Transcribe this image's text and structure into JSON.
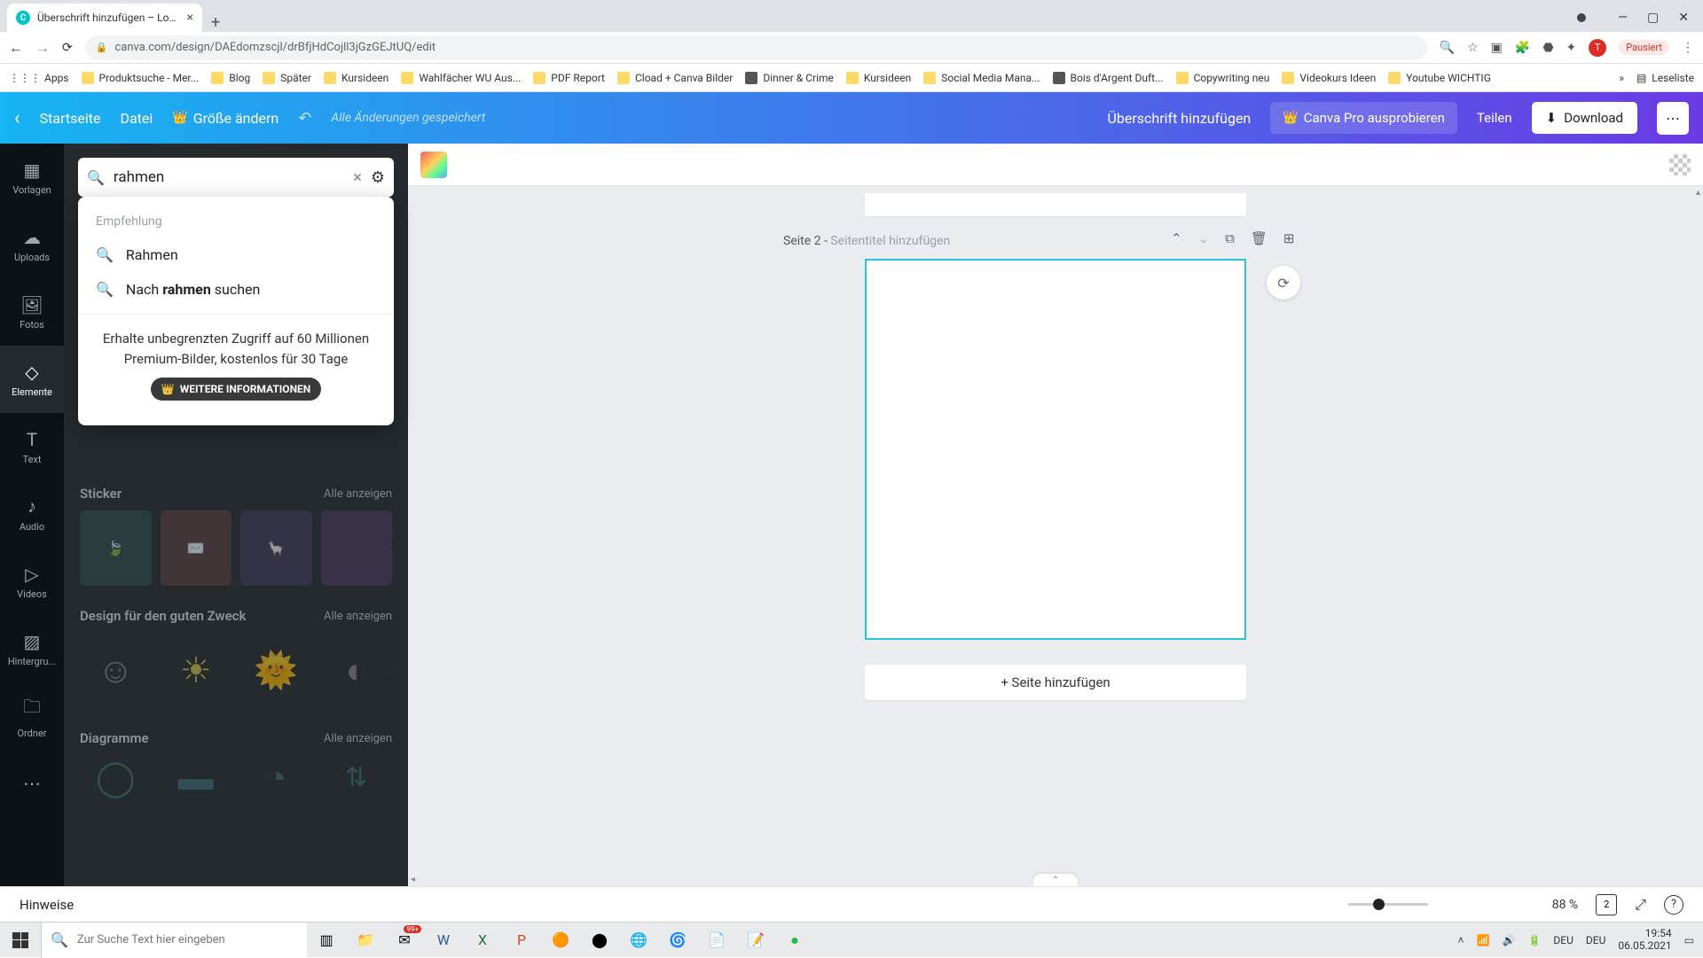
{
  "browser": {
    "tab_title": "Überschrift hinzufügen – Logo",
    "url": "canva.com/design/DAEdomzscjl/drBfjHdCojll3jGzGEJtUQ/edit",
    "pause_label": "Pausiert",
    "avatar_initial": "T",
    "bookmarks": {
      "apps": "Apps",
      "items": [
        "Produktsuche - Mer...",
        "Blog",
        "Später",
        "Kursideen",
        "Wahlfächer WU Aus...",
        "PDF Report",
        "Cload + Canva Bilder",
        "Dinner & Crime",
        "Kursideen",
        "Social Media Mana...",
        "Bois d'Argent Duft...",
        "Copywriting neu",
        "Videokurs Ideen",
        "Youtube WICHTIG"
      ],
      "reading_list": "Leseliste"
    }
  },
  "header": {
    "home": "Startseite",
    "file": "Datei",
    "resize": "Größe ändern",
    "saved": "Alle Änderungen gespeichert",
    "doc_title": "Überschrift hinzufügen",
    "try_pro": "Canva Pro ausprobieren",
    "share": "Teilen",
    "download": "Download"
  },
  "rail": {
    "templates": "Vorlagen",
    "uploads": "Uploads",
    "photos": "Fotos",
    "elements": "Elemente",
    "text": "Text",
    "audio": "Audio",
    "videos": "Videos",
    "background": "Hintergru...",
    "folder": "Ordner"
  },
  "search": {
    "value": "rahmen",
    "recommend_label": "Empfehlung",
    "suggestions": {
      "item1": "Rahmen",
      "item2_prefix": "Nach ",
      "item2_bold": "rahmen",
      "item2_suffix": " suchen"
    },
    "promo_text": "Erhalte unbegrenzten Zugriff auf 60 Millionen Premium-Bilder, kostenlos für 30 Tage",
    "promo_btn": "WEITERE INFORMATIONEN"
  },
  "categories": {
    "sticker": {
      "title": "Sticker",
      "all": "Alle anzeigen"
    },
    "good_cause": {
      "title": "Design für den guten Zweck",
      "all": "Alle anzeigen"
    },
    "diagrams": {
      "title": "Diagramme",
      "all": "Alle anzeigen"
    }
  },
  "page": {
    "label_prefix": "Seite 2",
    "label_sep": " - ",
    "title_placeholder": "Seitentitel hinzufügen",
    "add_page": "+ Seite hinzufügen"
  },
  "bottom": {
    "hints": "Hinweise",
    "zoom": "88 %",
    "page_count": "2"
  },
  "taskbar": {
    "search_placeholder": "Zur Suche Text hier eingeben",
    "lang1": "DEU",
    "lang2": "DEU",
    "time": "19:54",
    "date": "06.05.2021"
  }
}
